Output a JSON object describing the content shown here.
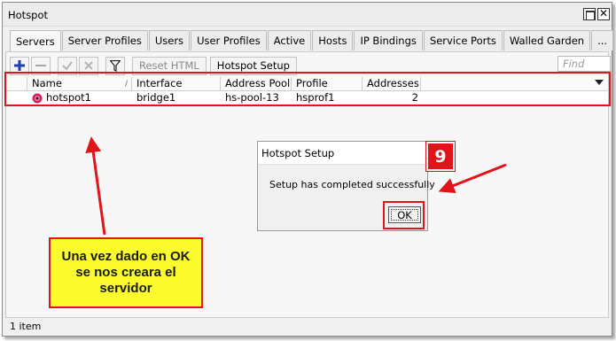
{
  "window": {
    "title": "Hotspot"
  },
  "tabs": [
    {
      "label": "Servers",
      "active": true
    },
    {
      "label": "Server Profiles",
      "active": false
    },
    {
      "label": "Users",
      "active": false
    },
    {
      "label": "User Profiles",
      "active": false
    },
    {
      "label": "Active",
      "active": false
    },
    {
      "label": "Hosts",
      "active": false
    },
    {
      "label": "IP Bindings",
      "active": false
    },
    {
      "label": "Service Ports",
      "active": false
    },
    {
      "label": "Walled Garden",
      "active": false
    },
    {
      "label": "...",
      "active": false
    }
  ],
  "toolbar": {
    "add_icon": "plus-icon",
    "remove_icon": "minus-icon",
    "enable_icon": "check-icon",
    "disable_icon": "x-icon",
    "filter_icon": "filter-icon",
    "reset_html_label": "Reset HTML",
    "hotspot_setup_label": "Hotspot Setup",
    "find_placeholder": "Find"
  },
  "table": {
    "columns": [
      "Name",
      "Interface",
      "Address Pool",
      "Profile",
      "Addresses ..."
    ],
    "rows": [
      {
        "name": "hotspot1",
        "interface": "bridge1",
        "address_pool": "hs-pool-13",
        "profile": "hsprof1",
        "addresses": "2",
        "icon": "hotspot-server-icon"
      }
    ]
  },
  "status": {
    "item_count": "1 item"
  },
  "dialog": {
    "title": "Hotspot Setup",
    "message": "Setup has completed successfully",
    "ok_label": "OK"
  },
  "annotation": {
    "step_number": "9",
    "note_text": "Una vez dado en OK se nos creara el servidor",
    "highlight_color": "#e2141b",
    "note_background": "#fbfb2e"
  }
}
